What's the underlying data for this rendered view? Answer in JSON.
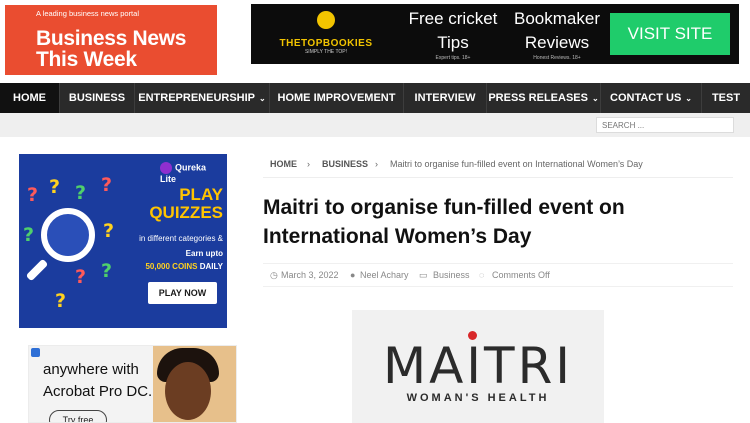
{
  "site": {
    "tagline": "A leading business news portal",
    "name_line1": "Business News",
    "name_line2": "This Week"
  },
  "top_ad": {
    "brand": "THETOPBOOKIES",
    "brand_tagline": "SIMPLY THE TOP!",
    "caption1_line1": "Free cricket",
    "caption1_line2": "Tips",
    "caption1_fine": "Expert tips. 18+",
    "caption2_line1": "Bookmaker",
    "caption2_line2": "Reviews",
    "caption2_fine": "Honest Reviews. 18+",
    "cta": "VISIT SITE"
  },
  "nav": {
    "items": [
      {
        "label": "HOME"
      },
      {
        "label": "BUSINESS"
      },
      {
        "label": "ENTREPRENEURSHIP",
        "dropdown": true
      },
      {
        "label": "HOME IMPROVEMENT"
      },
      {
        "label": "INTERVIEW"
      },
      {
        "label": "PRESS RELEASES",
        "dropdown": true
      },
      {
        "label": "CONTACT US",
        "dropdown": true
      },
      {
        "label": "TEST"
      }
    ],
    "caret": "⌄"
  },
  "search": {
    "placeholder": "SEARCH ..."
  },
  "quiz_ad": {
    "badge": "Qureka Lite",
    "headline1": "PLAY",
    "headline2": "QUIZZES",
    "categories": "in different categories &",
    "earn_prefix": "Earn upto",
    "earn_amount": "50,000 COINS",
    "earn_suffix": "DAILY",
    "cta": "PLAY NOW"
  },
  "acrobat_ad": {
    "line1": "anywhere with",
    "line2": "Acrobat Pro DC.",
    "cta": "Try free"
  },
  "breadcrumb": {
    "home": "HOME",
    "section": "BUSINESS",
    "current": "Maitri to organise fun-filled event on International Women’s Day",
    "separator": "›"
  },
  "article": {
    "title": "Maitri to organise fun-filled event on International Women’s Day",
    "date": "March 3, 2022",
    "author": "Neel Achary",
    "category": "Business",
    "comments": "Comments Off"
  },
  "featured_image": {
    "wordmark": "MAITRI",
    "subline": "WOMAN'S HEALTH"
  },
  "colors": {
    "brand": "#ea4d30",
    "nav_bg": "#2a2a2a",
    "quiz_bg": "#1b3c9e",
    "cta_green": "#1fcc6b"
  }
}
